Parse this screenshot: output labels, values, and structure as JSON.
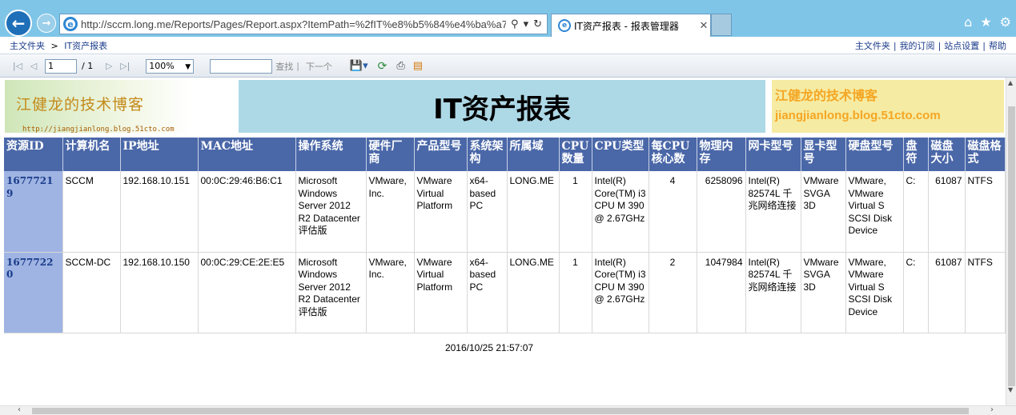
{
  "browser": {
    "url": "http://sccm.long.me/Reports/Pages/Report.aspx?ItemPath=%2fIT%e8%b5%84%e4%ba%a7",
    "tab_title": "IT资产报表 - 报表管理器",
    "icons": [
      "back-arrow-icon",
      "forward-arrow-icon",
      "ie-logo-icon",
      "search-icon",
      "dropdown-icon",
      "refresh-icon",
      "close-icon",
      "home-icon",
      "star-icon",
      "gear-icon"
    ]
  },
  "header": {
    "breadcrumb_home": "主文件夹",
    "breadcrumb_sep": ">",
    "breadcrumb_current": "IT资产报表",
    "links": [
      "主文件夹",
      "我的订阅",
      "站点设置",
      "帮助"
    ],
    "link_sep": "|"
  },
  "toolbar": {
    "page": "1",
    "page_of": "/ 1",
    "zoom": "100%",
    "find_value": "",
    "find_label": "查找",
    "find_sep": "|",
    "next_label": "下一个"
  },
  "report": {
    "logo_text": "江健龙的技术博客",
    "logo_url": "http://jiangjianlong.blog.51cto.com",
    "title": "IT资产报表",
    "right_name": "江健龙的技术博客",
    "right_url": "jiangjianlong.blog.51cto.com",
    "columns": [
      "资源ID",
      "计算机名",
      "IP地址",
      "MAC地址",
      "操作系统",
      "硬件厂商",
      "产品型号",
      "系统架构",
      "所属域",
      "CPU数量",
      "CPU类型",
      "每CPU核心数",
      "物理内存",
      "网卡型号",
      "显卡型号",
      "硬盘型号",
      "盘符",
      "磁盘大小",
      "磁盘格式"
    ],
    "rows": [
      [
        "16777219",
        "SCCM",
        "192.168.10.151",
        "00:0C:29:46:B6:C1",
        "Microsoft Windows Server 2012 R2 Datacenter 评估版",
        "VMware, Inc.",
        "VMware Virtual Platform",
        "x64-based PC",
        "LONG.ME",
        "1",
        "Intel(R) Core(TM) i3 CPU M 390 @ 2.67GHz",
        "4",
        "6258096",
        "Intel(R) 82574L 千兆网络连接",
        "VMware SVGA 3D",
        "VMware, VMware Virtual S SCSI Disk Device",
        "C:",
        "61087",
        "NTFS"
      ],
      [
        "16777220",
        "SCCM-DC",
        "192.168.10.150",
        "00:0C:29:CE:2E:E5",
        "Microsoft Windows Server 2012 R2 Datacenter 评估版",
        "VMware, Inc.",
        "VMware Virtual Platform",
        "x64-based PC",
        "LONG.ME",
        "1",
        "Intel(R) Core(TM) i3 CPU M 390 @ 2.67GHz",
        "2",
        "1047984",
        "Intel(R) 82574L 千兆网络连接",
        "VMware SVGA 3D",
        "VMware, VMware Virtual S SCSI Disk Device",
        "C:",
        "61087",
        "NTFS"
      ]
    ],
    "timestamp": "2016/10/25 21:57:07"
  }
}
